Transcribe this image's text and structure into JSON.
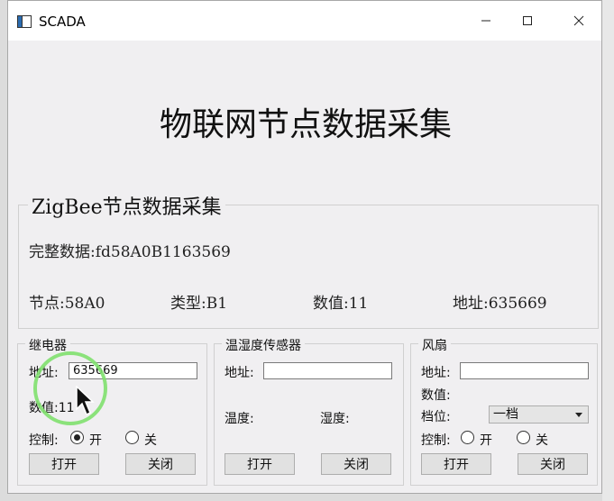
{
  "window": {
    "title": "SCADA"
  },
  "main_title": "物联网节点数据采集",
  "zigbee": {
    "group_title": "ZigBee节点数据采集",
    "full_data": "完整数据:fd58A0B1163569",
    "node": "节点:58A0",
    "type": "类型:B1",
    "value": "数值:11",
    "address": "地址:635669"
  },
  "relay": {
    "group_title": "继电器",
    "address_label": "地址:",
    "address_value": "635669",
    "value_label": "数值:11",
    "control_label": "控制:",
    "on_label": "开",
    "off_label": "关",
    "on_checked": true,
    "open_button": "打开",
    "close_button": "关闭"
  },
  "th_sensor": {
    "group_title": "温湿度传感器",
    "address_label": "地址:",
    "address_value": "",
    "temp_label": "温度:",
    "humidity_label": "湿度:",
    "open_button": "打开",
    "close_button": "关闭"
  },
  "fan": {
    "group_title": "风扇",
    "address_label": "地址:",
    "address_value": "",
    "value_label": "数值:",
    "gear_label": "档位:",
    "gear_selected": "一档",
    "control_label": "控制:",
    "on_label": "开",
    "off_label": "关",
    "open_button": "打开",
    "close_button": "关闭"
  },
  "icons": [
    "app-icon",
    "minimize-icon",
    "maximize-icon",
    "close-icon",
    "mouse-cursor-icon"
  ]
}
